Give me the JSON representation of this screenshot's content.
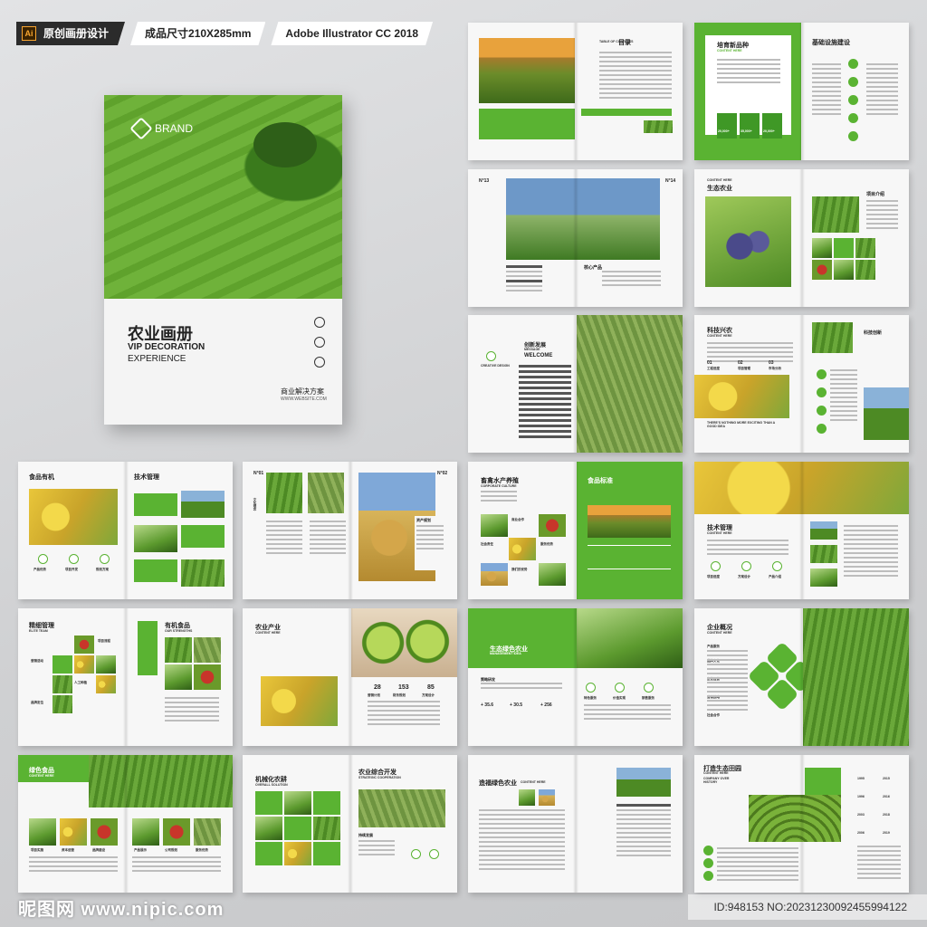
{
  "header": {
    "tag_design": "原创画册设计",
    "tag_size": "成品尺寸210X285mm",
    "tag_software": "Adobe Illustrator CC 2018",
    "ai_icon": "Ai"
  },
  "cover": {
    "brand": "BRAND",
    "title": "农业画册",
    "subtitle_line1": "VIP DECORATION",
    "subtitle_line2": "EXPERIENCE",
    "bottom_title": "商业解决方案",
    "website": "WWW.WEBSITE.COM"
  },
  "spreads": {
    "s1": {
      "title": "目录",
      "sub": "TABLE OF CONTENTS"
    },
    "s2": {
      "title": "培育新品种",
      "title2": "基础设施建设",
      "sub": "CONTENT HERE",
      "stat1": "20,000+",
      "stat2": "35,000+",
      "stat3": "20,000+"
    },
    "s3": {
      "num_left": "N°13",
      "num_right": "N°14",
      "label": "核心产品"
    },
    "s4": {
      "title": "生态农业",
      "sub": "CONTENT HERE",
      "label": "项目介绍"
    },
    "s5": {
      "title": "创新发展",
      "sub": "MESSAGE",
      "welcome": "WELCOME",
      "logo_text": "CREATIVE DESIGN"
    },
    "s6": {
      "title": "科技兴农",
      "sub": "CONTENT HERE",
      "label": "科技创新",
      "n1": "01",
      "n2": "02",
      "n3": "03",
      "c1": "工程进度",
      "c2": "项目管理",
      "c3": "市场分析",
      "quote": "THERE'S NOTHING MORE EXCITING THAN A GOOD IDEA"
    },
    "s7": {
      "title": "食品有机",
      "title2": "技术管理",
      "sub": "CONTENT HERE",
      "icon1": "产品优势",
      "icon2": "项目开发",
      "icon3": "规划方案"
    },
    "s8": {
      "num_left": "N°01",
      "num_right": "N°02",
      "side": "文化理念",
      "label": "资产规划"
    },
    "s9": {
      "title": "畜禽水产养殖",
      "title2": "食品标准",
      "sub": "CORPORATE CULTURE",
      "c1": "商业合作",
      "c2": "产品展示",
      "c3": "社会责任",
      "c4": "服务优势",
      "c5": "我们的优势"
    },
    "s10": {
      "title": "技术管理",
      "sub": "CONTENT HERE",
      "c1": "项目进度",
      "c2": "方案设计",
      "c3": "产品介绍"
    },
    "s11": {
      "title": "精细管理",
      "title2": "有机食品",
      "sub": "ELITE TEAM",
      "sub2": "OUR STRENGTHS",
      "c1": "项目流程",
      "c2": "营销活动",
      "c3": "人工种植",
      "c4": "品牌定位"
    },
    "s12": {
      "title": "农业产业",
      "sub": "CONTENT HERE",
      "n1": "28",
      "n2": "153",
      "n3": "85",
      "c1": "营销计划",
      "c2": "财务规划",
      "c3": "方案设计"
    },
    "s13": {
      "title": "生态绿色农业",
      "sub": "MANAGEMENT IDEA",
      "s1": "+ 35.6",
      "s2": "+ 30.5",
      "s3": "+ 256",
      "c1": "策略研发",
      "c2": "特色服务",
      "c3": "价值实现",
      "c4": "销售服务"
    },
    "s14": {
      "title": "企业概况",
      "sub": "CONTENT HERE",
      "c1": "产品服务",
      "c2": "品牌文化",
      "c3": "企业经营",
      "c4": "营销战略",
      "c5": "社会合作"
    },
    "s15": {
      "title": "绿色食品",
      "sub": "CONTENT HERE",
      "c1": "项目实施",
      "c2": "资本运营",
      "c3": "品牌建设",
      "c4": "产品展示",
      "c5": "公司规划",
      "c6": "服务优势"
    },
    "s16": {
      "title": "机械化农耕",
      "title2": "农业综合开发",
      "sub": "OVERALL SOLUTION",
      "sub2": "STRATEGIC COOPERATION",
      "label": "持续发展"
    },
    "s17": {
      "title": "造福绿色农业",
      "sub": "CONTENT HERE"
    },
    "s18": {
      "title": "打造生态田园",
      "sub": "CONTENT HERE",
      "sub2": "COMPANY OVER HISTORY",
      "y1": "1995",
      "y2": "1996",
      "y3": "2003",
      "y4": "2006",
      "y5": "2015",
      "y6": "2016",
      "y7": "2018",
      "y8": "2019"
    }
  },
  "footer": {
    "watermark": "昵图网 www.nipic.com",
    "id": "ID:948153 NO:20231230092455994122"
  }
}
